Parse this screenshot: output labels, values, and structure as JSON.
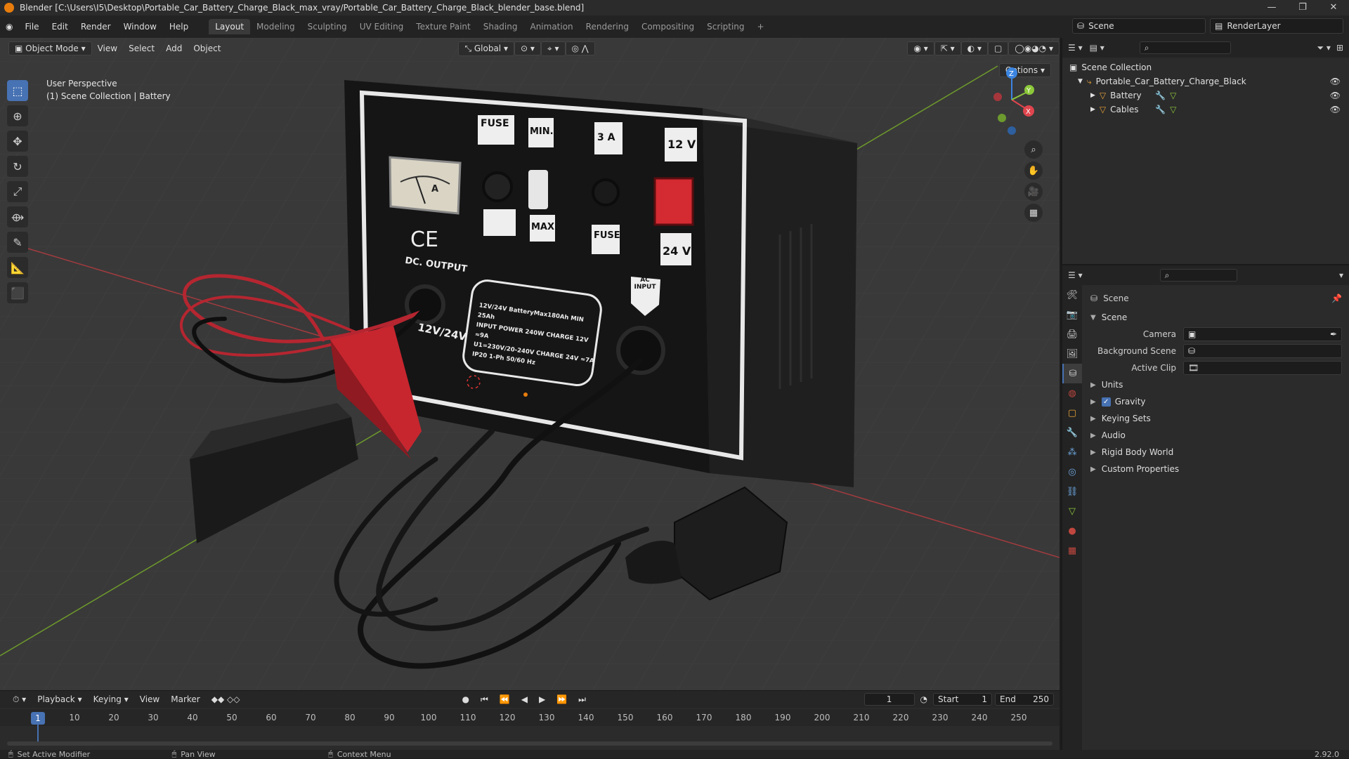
{
  "window": {
    "title": "Blender [C:\\Users\\I5\\Desktop\\Portable_Car_Battery_Charge_Black_max_vray/Portable_Car_Battery_Charge_Black_blender_base.blend]",
    "controls": [
      "—",
      "❐",
      "✕"
    ]
  },
  "menu": [
    "File",
    "Edit",
    "Render",
    "Window",
    "Help"
  ],
  "workspaces": [
    "Layout",
    "Modeling",
    "Sculpting",
    "UV Editing",
    "Texture Paint",
    "Shading",
    "Animation",
    "Rendering",
    "Compositing",
    "Scripting"
  ],
  "active_workspace": "Layout",
  "top_right": {
    "scene": "Scene",
    "view_layer": "RenderLayer"
  },
  "viewport": {
    "mode": "Object Mode",
    "menus": [
      "View",
      "Select",
      "Add",
      "Object"
    ],
    "orientation": "Global",
    "options_label": "Options",
    "info_line1": "User Perspective",
    "info_line2": "(1) Scene Collection | Battery",
    "tools": [
      "select-box",
      "cursor",
      "move",
      "rotate",
      "scale",
      "transform",
      "annotate",
      "measure",
      "add-cube"
    ],
    "gizmo_axes": {
      "x": "X",
      "y": "Y",
      "z": "Z"
    },
    "colors": {
      "x_axis": "#e0454d",
      "y_axis": "#8cc83a",
      "z_axis": "#3b85e0",
      "grid_bg": "#3a3a3a",
      "clamp_red": "#d32a34"
    }
  },
  "charger_labels": {
    "fuse_top": "FUSE",
    "min": "MIN.",
    "amp": "3 A",
    "v12": "12 V",
    "max": "MAX.",
    "fuse_mid": "FUSE",
    "v24": "24 V",
    "ce": "CE",
    "dc_output": "DC. OUTPUT",
    "output_voltage": "12V/24V",
    "ac_input": "AC INPUT",
    "meter_letter": "A",
    "spec1": "12V/24V  BatteryMax180Ah MIN 25Ah",
    "spec2": "INPUT POWER 240W  CHARGE 12V ≈9A",
    "spec3": "U1=230V/20-240V  CHARGE 24V ≈7A",
    "spec4": "IP20  1-Ph 50/60 Hz"
  },
  "timeline": {
    "menus": [
      "Playback",
      "Keying",
      "View",
      "Marker"
    ],
    "current_frame": "1",
    "start_label": "Start",
    "start": "1",
    "end_label": "End",
    "end": "250",
    "ticks": [
      "1",
      "10",
      "20",
      "30",
      "40",
      "50",
      "60",
      "70",
      "80",
      "90",
      "100",
      "110",
      "120",
      "130",
      "140",
      "150",
      "160",
      "170",
      "180",
      "190",
      "200",
      "210",
      "220",
      "230",
      "240",
      "250"
    ]
  },
  "outliner": {
    "root": "Scene Collection",
    "collection": "Portable_Car_Battery_Charge_Black",
    "items": [
      {
        "name": "Battery"
      },
      {
        "name": "Cables"
      }
    ]
  },
  "properties": {
    "header": "Scene",
    "panel": "Scene",
    "fields": [
      {
        "label": "Camera",
        "value": ""
      },
      {
        "label": "Background Scene",
        "value": ""
      },
      {
        "label": "Active Clip",
        "value": ""
      }
    ],
    "sections": [
      "Units",
      "Gravity",
      "Keying Sets",
      "Audio",
      "Rigid Body World",
      "Custom Properties"
    ],
    "gravity_checked": true
  },
  "status": {
    "left": "Set Active Modifier",
    "middle": "Pan View",
    "right": "Context Menu",
    "version": "2.92.0"
  }
}
